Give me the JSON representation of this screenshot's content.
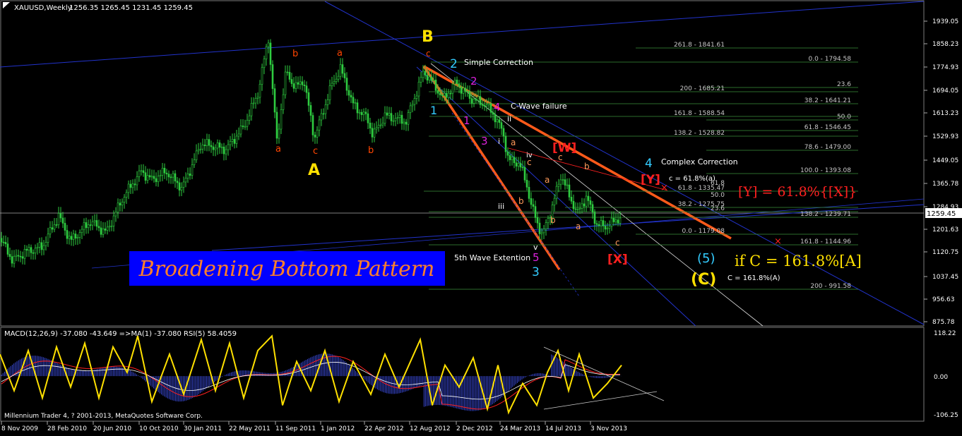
{
  "chart_data": [
    {
      "type": "candlestick",
      "symbol_header": "XAUUSD,Weekly",
      "ohlc_header": "1256.35 1265.45 1231.45 1259.45",
      "last_price": "1259.45",
      "ylim": [
        880,
        1960
      ],
      "y_ticks": [
        "1939.05",
        "1858.23",
        "1774.93",
        "1694.05",
        "1613.23",
        "1529.93",
        "1449.05",
        "1365.78",
        "1284.93",
        "1201.63",
        "1120.75",
        "1037.45",
        "956.63",
        "875.78"
      ],
      "x_ticks": [
        "8 Nov 2009",
        "28 Feb 2010",
        "20 Jun 2010",
        "10 Oct 2010",
        "30 Jan 2011",
        "22 May 2011",
        "11 Sep 2011",
        "1 Jan 2012",
        "22 Apr 2012",
        "12 Aug 2012",
        "2 Dec 2012",
        "24 Mar 2013",
        "14 Jul 2013",
        "3 Nov 2013"
      ],
      "price_path": [
        {
          "x": 0,
          "y": 1180
        },
        {
          "x": 18,
          "y": 1100
        },
        {
          "x": 35,
          "y": 1130
        },
        {
          "x": 60,
          "y": 1150
        },
        {
          "x": 83,
          "y": 1260
        },
        {
          "x": 100,
          "y": 1170
        },
        {
          "x": 128,
          "y": 1240
        },
        {
          "x": 150,
          "y": 1200
        },
        {
          "x": 175,
          "y": 1330
        },
        {
          "x": 200,
          "y": 1420
        },
        {
          "x": 215,
          "y": 1390
        },
        {
          "x": 235,
          "y": 1420
        },
        {
          "x": 258,
          "y": 1360
        },
        {
          "x": 285,
          "y": 1520
        },
        {
          "x": 320,
          "y": 1500
        },
        {
          "x": 345,
          "y": 1580
        },
        {
          "x": 365,
          "y": 1700
        },
        {
          "x": 380,
          "y": 1900
        },
        {
          "x": 392,
          "y": 1530
        },
        {
          "x": 405,
          "y": 1780
        },
        {
          "x": 418,
          "y": 1720
        },
        {
          "x": 430,
          "y": 1750
        },
        {
          "x": 445,
          "y": 1540
        },
        {
          "x": 458,
          "y": 1640
        },
        {
          "x": 468,
          "y": 1720
        },
        {
          "x": 482,
          "y": 1790
        },
        {
          "x": 500,
          "y": 1660
        },
        {
          "x": 520,
          "y": 1610
        },
        {
          "x": 528,
          "y": 1550
        },
        {
          "x": 545,
          "y": 1620
        },
        {
          "x": 575,
          "y": 1600
        },
        {
          "x": 600,
          "y": 1780
        },
        {
          "x": 612,
          "y": 1740
        },
        {
          "x": 628,
          "y": 1680
        },
        {
          "x": 645,
          "y": 1740
        },
        {
          "x": 668,
          "y": 1680
        },
        {
          "x": 688,
          "y": 1660
        },
        {
          "x": 700,
          "y": 1620
        },
        {
          "x": 712,
          "y": 1560
        },
        {
          "x": 720,
          "y": 1460
        },
        {
          "x": 735,
          "y": 1450
        },
        {
          "x": 745,
          "y": 1380
        },
        {
          "x": 752,
          "y": 1300
        },
        {
          "x": 760,
          "y": 1240
        },
        {
          "x": 768,
          "y": 1190
        },
        {
          "x": 780,
          "y": 1280
        },
        {
          "x": 795,
          "y": 1410
        },
        {
          "x": 806,
          "y": 1330
        },
        {
          "x": 818,
          "y": 1270
        },
        {
          "x": 830,
          "y": 1330
        },
        {
          "x": 845,
          "y": 1230
        },
        {
          "x": 858,
          "y": 1220
        },
        {
          "x": 870,
          "y": 1240
        },
        {
          "x": 880,
          "y": 1260
        }
      ],
      "fib_levels_right": [
        "261.8 - 1841.61",
        "0.0 - 1794.58",
        "23.6",
        "200 - 1685.21",
        "38.2 - 1641.21",
        "161.8 - 1588.54",
        "50.0",
        "61.8 - 1546.45",
        "138.2 - 1528.82",
        "78.6 - 1479.00",
        "100.0 - 1393.08",
        "61.8 - 1335.47",
        "38.2 - 1275.75",
        "23.6",
        "138.2 - 1239.71",
        "0.0 - 1179.08",
        "161.8 - 1144.96",
        "200 - 991.58"
      ],
      "fib_small": [
        "50.0",
        "61.8"
      ],
      "annotations": {
        "wave_B": "B",
        "wave_A": "A",
        "wave_C": "(C)",
        "wave_5": "(5)",
        "simple_num": "2",
        "simple": "Simple Correction",
        "cwave": "C-Wave failure",
        "complex_num": "4",
        "complex": "Complex Correction",
        "c_ratio": "c = 61.8%(a)",
        "fifth_ext": "5th Wave Extention",
        "W": "[W]",
        "Y": "[Y]",
        "X": "[X]",
        "y_ratio": "[Y]  = 61.8%{[X]}",
        "if_c": "if C  = 161.8%[A]",
        "c_161": "C = 161.8%(A)",
        "pattern_title": "Broadening Bottom Pattern",
        "small_c": "c",
        "n1": "1",
        "n1b": "1",
        "n2": "2",
        "n3": "3",
        "n3b": "3",
        "n4": "4",
        "n5": "5",
        "a": "a",
        "b": "b",
        "i": "i",
        "ii": "ii",
        "iii": "iii",
        "iv": "iv",
        "v": "v",
        "x_mark": "×"
      },
      "credit": "Millennium Trader 4, ? 2001-2013, MetaQuotes Software Corp."
    },
    {
      "type": "line",
      "indicator_header": "MACD(12,26,9) -37.080 -43.649  =>MA(1) -37.080  RSI(5) 58.4059",
      "ylim": [
        -106.25,
        118.22
      ],
      "y_ticks": [
        "118.22",
        "0.00",
        "-106.25"
      ],
      "rsi_path": [
        {
          "x": 0,
          "y": 60
        },
        {
          "x": 20,
          "y": -40
        },
        {
          "x": 40,
          "y": 70
        },
        {
          "x": 60,
          "y": -60
        },
        {
          "x": 80,
          "y": 80
        },
        {
          "x": 100,
          "y": -30
        },
        {
          "x": 120,
          "y": 90
        },
        {
          "x": 140,
          "y": -60
        },
        {
          "x": 160,
          "y": 80
        },
        {
          "x": 180,
          "y": 10
        },
        {
          "x": 195,
          "y": 110
        },
        {
          "x": 215,
          "y": -70
        },
        {
          "x": 240,
          "y": 60
        },
        {
          "x": 260,
          "y": -50
        },
        {
          "x": 285,
          "y": 100
        },
        {
          "x": 305,
          "y": -40
        },
        {
          "x": 325,
          "y": 90
        },
        {
          "x": 345,
          "y": -60
        },
        {
          "x": 365,
          "y": 70
        },
        {
          "x": 385,
          "y": 110
        },
        {
          "x": 400,
          "y": -80
        },
        {
          "x": 420,
          "y": 40
        },
        {
          "x": 440,
          "y": -40
        },
        {
          "x": 460,
          "y": 70
        },
        {
          "x": 480,
          "y": -70
        },
        {
          "x": 500,
          "y": 40
        },
        {
          "x": 525,
          "y": -50
        },
        {
          "x": 545,
          "y": 60
        },
        {
          "x": 565,
          "y": -30
        },
        {
          "x": 595,
          "y": 100
        },
        {
          "x": 612,
          "y": -80
        },
        {
          "x": 630,
          "y": 30
        },
        {
          "x": 650,
          "y": -30
        },
        {
          "x": 670,
          "y": 50
        },
        {
          "x": 690,
          "y": -90
        },
        {
          "x": 705,
          "y": 30
        },
        {
          "x": 720,
          "y": -100
        },
        {
          "x": 740,
          "y": -20
        },
        {
          "x": 760,
          "y": -80
        },
        {
          "x": 775,
          "y": 10
        },
        {
          "x": 790,
          "y": 70
        },
        {
          "x": 805,
          "y": -40
        },
        {
          "x": 820,
          "y": 60
        },
        {
          "x": 840,
          "y": -60
        },
        {
          "x": 860,
          "y": -20
        },
        {
          "x": 880,
          "y": 30
        }
      ]
    }
  ]
}
